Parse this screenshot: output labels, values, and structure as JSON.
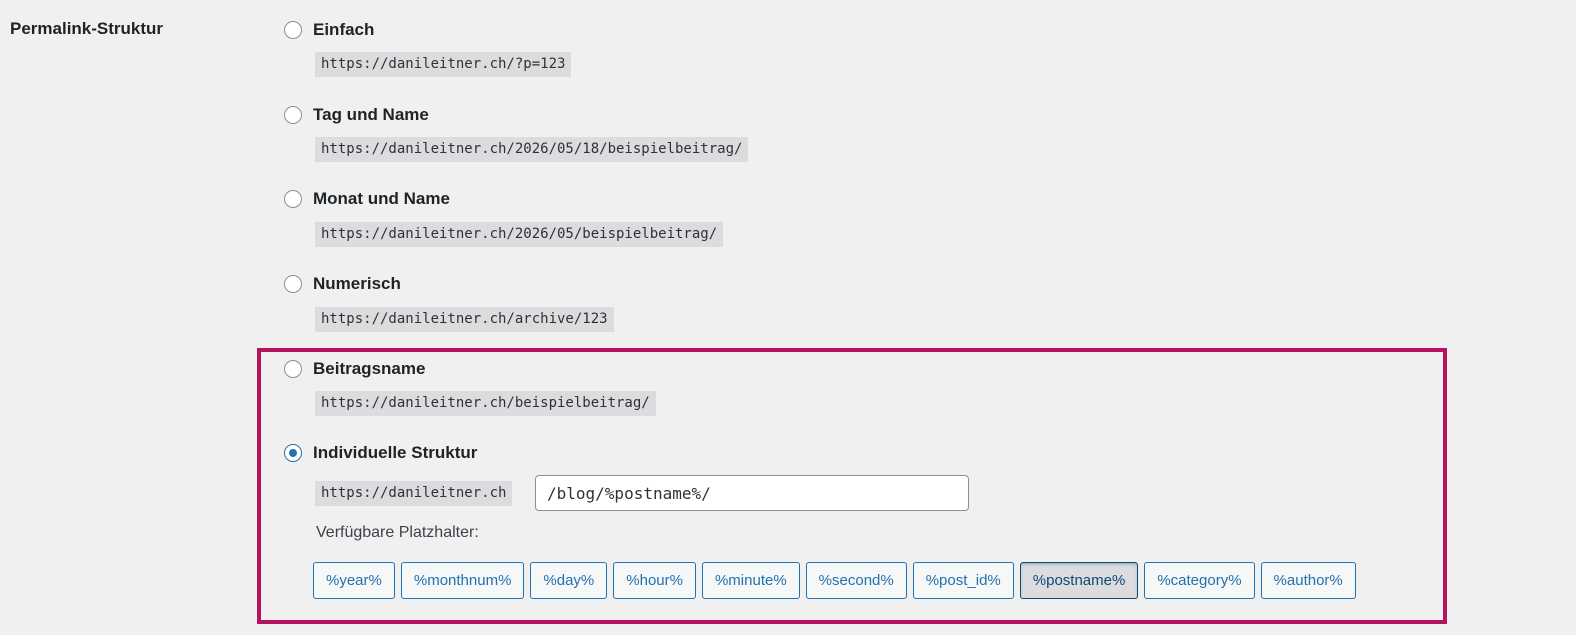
{
  "section_label": "Permalink-Struktur",
  "options": [
    {
      "label": "Einfach",
      "example": "https://danileitner.ch/?p=123",
      "checked": false
    },
    {
      "label": "Tag und Name",
      "example": "https://danileitner.ch/2026/05/18/beispielbeitrag/",
      "checked": false
    },
    {
      "label": "Monat und Name",
      "example": "https://danileitner.ch/2026/05/beispielbeitrag/",
      "checked": false
    },
    {
      "label": "Numerisch",
      "example": "https://danileitner.ch/archive/123",
      "checked": false
    },
    {
      "label": "Beitragsname",
      "example": "https://danileitner.ch/beispielbeitrag/",
      "checked": false
    },
    {
      "label": "Individuelle Struktur",
      "checked": true
    }
  ],
  "custom": {
    "base_url": "https://danileitner.ch",
    "structure_value": "/blog/%postname%/",
    "available_label": "Verfügbare Platzhalter:"
  },
  "tags": [
    {
      "label": "%year%",
      "active": false
    },
    {
      "label": "%monthnum%",
      "active": false
    },
    {
      "label": "%day%",
      "active": false
    },
    {
      "label": "%hour%",
      "active": false
    },
    {
      "label": "%minute%",
      "active": false
    },
    {
      "label": "%second%",
      "active": false
    },
    {
      "label": "%post_id%",
      "active": false
    },
    {
      "label": "%postname%",
      "active": true
    },
    {
      "label": "%category%",
      "active": false
    },
    {
      "label": "%author%",
      "active": false
    }
  ],
  "colors": {
    "highlight_border": "#b3135f",
    "accent": "#2271b1"
  }
}
